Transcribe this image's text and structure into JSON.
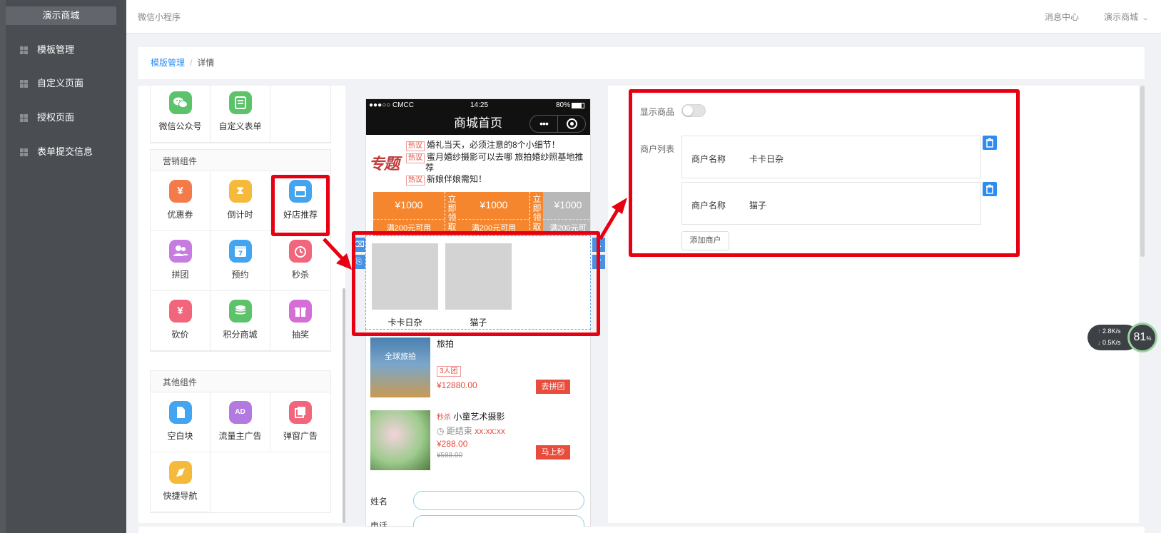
{
  "sidebar": {
    "brand": "演示商城",
    "items": [
      {
        "label": "模板管理"
      },
      {
        "label": "自定义页面"
      },
      {
        "label": "授权页面"
      },
      {
        "label": "表单提交信息"
      }
    ]
  },
  "header": {
    "app_title": "微信小程序",
    "message_center": "消息中心",
    "user": "演示商城"
  },
  "breadcrumb": {
    "parent": "模版管理",
    "separator": "/",
    "current": "详情"
  },
  "palette": {
    "top_items": [
      {
        "label": "微信公众号",
        "icon": "wechat-icon",
        "color": "#5cc36b"
      },
      {
        "label": "自定义表单",
        "icon": "form-icon",
        "color": "#5cc36b"
      }
    ],
    "marketing": {
      "title": "营销组件",
      "items": [
        {
          "label": "优惠券",
          "icon": "coupon-icon",
          "glyph": "¥",
          "color": "#f47a4a"
        },
        {
          "label": "倒计时",
          "icon": "hourglass-icon",
          "glyph": "⧗",
          "color": "#f5b93c"
        },
        {
          "label": "好店推荐",
          "icon": "shop-icon",
          "glyph": "▤",
          "color": "#43a4ef"
        },
        {
          "label": "拼团",
          "icon": "group-icon",
          "glyph": "👥",
          "color": "#c77ce0"
        },
        {
          "label": "预约",
          "icon": "calendar-icon",
          "glyph": "7",
          "color": "#43a4ef"
        },
        {
          "label": "秒杀",
          "icon": "alarm-clock-icon",
          "glyph": "⏰",
          "color": "#f2667d"
        },
        {
          "label": "砍价",
          "icon": "bargain-icon",
          "glyph": "¥",
          "color": "#f2667d"
        },
        {
          "label": "积分商城",
          "icon": "points-icon",
          "glyph": "☰",
          "color": "#5cc36b"
        },
        {
          "label": "抽奖",
          "icon": "gift-icon",
          "glyph": "🎁",
          "color": "#d66ed8"
        }
      ]
    },
    "other": {
      "title": "其他组件",
      "items": [
        {
          "label": "空白块",
          "icon": "blank-block-icon",
          "glyph": "▯",
          "color": "#43a4ef"
        },
        {
          "label": "流量主广告",
          "icon": "ad-icon",
          "glyph": "AD",
          "color": "#b27ae0"
        },
        {
          "label": "弹窗广告",
          "icon": "popup-ad-icon",
          "glyph": "❐",
          "color": "#f2667d"
        },
        {
          "label": "快捷导航",
          "icon": "compass-icon",
          "glyph": "➶",
          "color": "#f5b93c"
        }
      ]
    }
  },
  "phone": {
    "carrier": "●●●○○ CMCC",
    "time": "14:25",
    "battery": "80%",
    "page_title": "商城首页",
    "capsule_dots": "•••",
    "news": {
      "badge": "专题",
      "tag": "热议",
      "lines": [
        "婚礼当天，必须注意的8个小细节！",
        "蜜月婚纱摄影可以去哪 旅拍婚纱照基地推",
        "荐",
        "新娘伴娘需知！"
      ]
    },
    "coupons": [
      {
        "amount": "¥1000",
        "condition": "满200元可用",
        "action": "立即领取",
        "color": "#f5862e"
      },
      {
        "amount": "¥1000",
        "condition": "满200元可用",
        "action": "立即领取",
        "color": "#f5862e"
      },
      {
        "amount": "¥1000",
        "condition": "满200元可",
        "action": "",
        "color": "#b8b8b8"
      }
    ],
    "shops": [
      {
        "name": "卡卡日杂"
      },
      {
        "name": "猫子"
      }
    ],
    "goods": [
      {
        "name": "旅拍",
        "thumb_text": "全球旅拍",
        "tag": "3人团",
        "price": "¥12880.00",
        "button": "去拼团"
      },
      {
        "name": "小童艺术摄影",
        "tag": "秒杀",
        "countdown_label": "距结束",
        "countdown": "xx:xx:xx",
        "price": "¥288.00",
        "old_price": "¥588.00",
        "button": "马上秒"
      }
    ],
    "form": [
      {
        "label": "姓名"
      },
      {
        "label": "电话"
      }
    ]
  },
  "settings": {
    "show_goods_label": "显示商品",
    "show_goods": false,
    "merchant_list_label": "商户列表",
    "merchant_field_label": "商户名称",
    "merchants": [
      {
        "name": "卡卡日杂"
      },
      {
        "name": "猫子"
      }
    ],
    "add_button": "添加商户"
  },
  "net_monitor": {
    "up": "2.8",
    "down": "0.5",
    "unit": "K/s",
    "percent": "81",
    "percent_sign": "%"
  },
  "colors": {
    "accent": "#2d8cf0",
    "annotation": "#e60012",
    "sidebar": "#4a4d52"
  }
}
